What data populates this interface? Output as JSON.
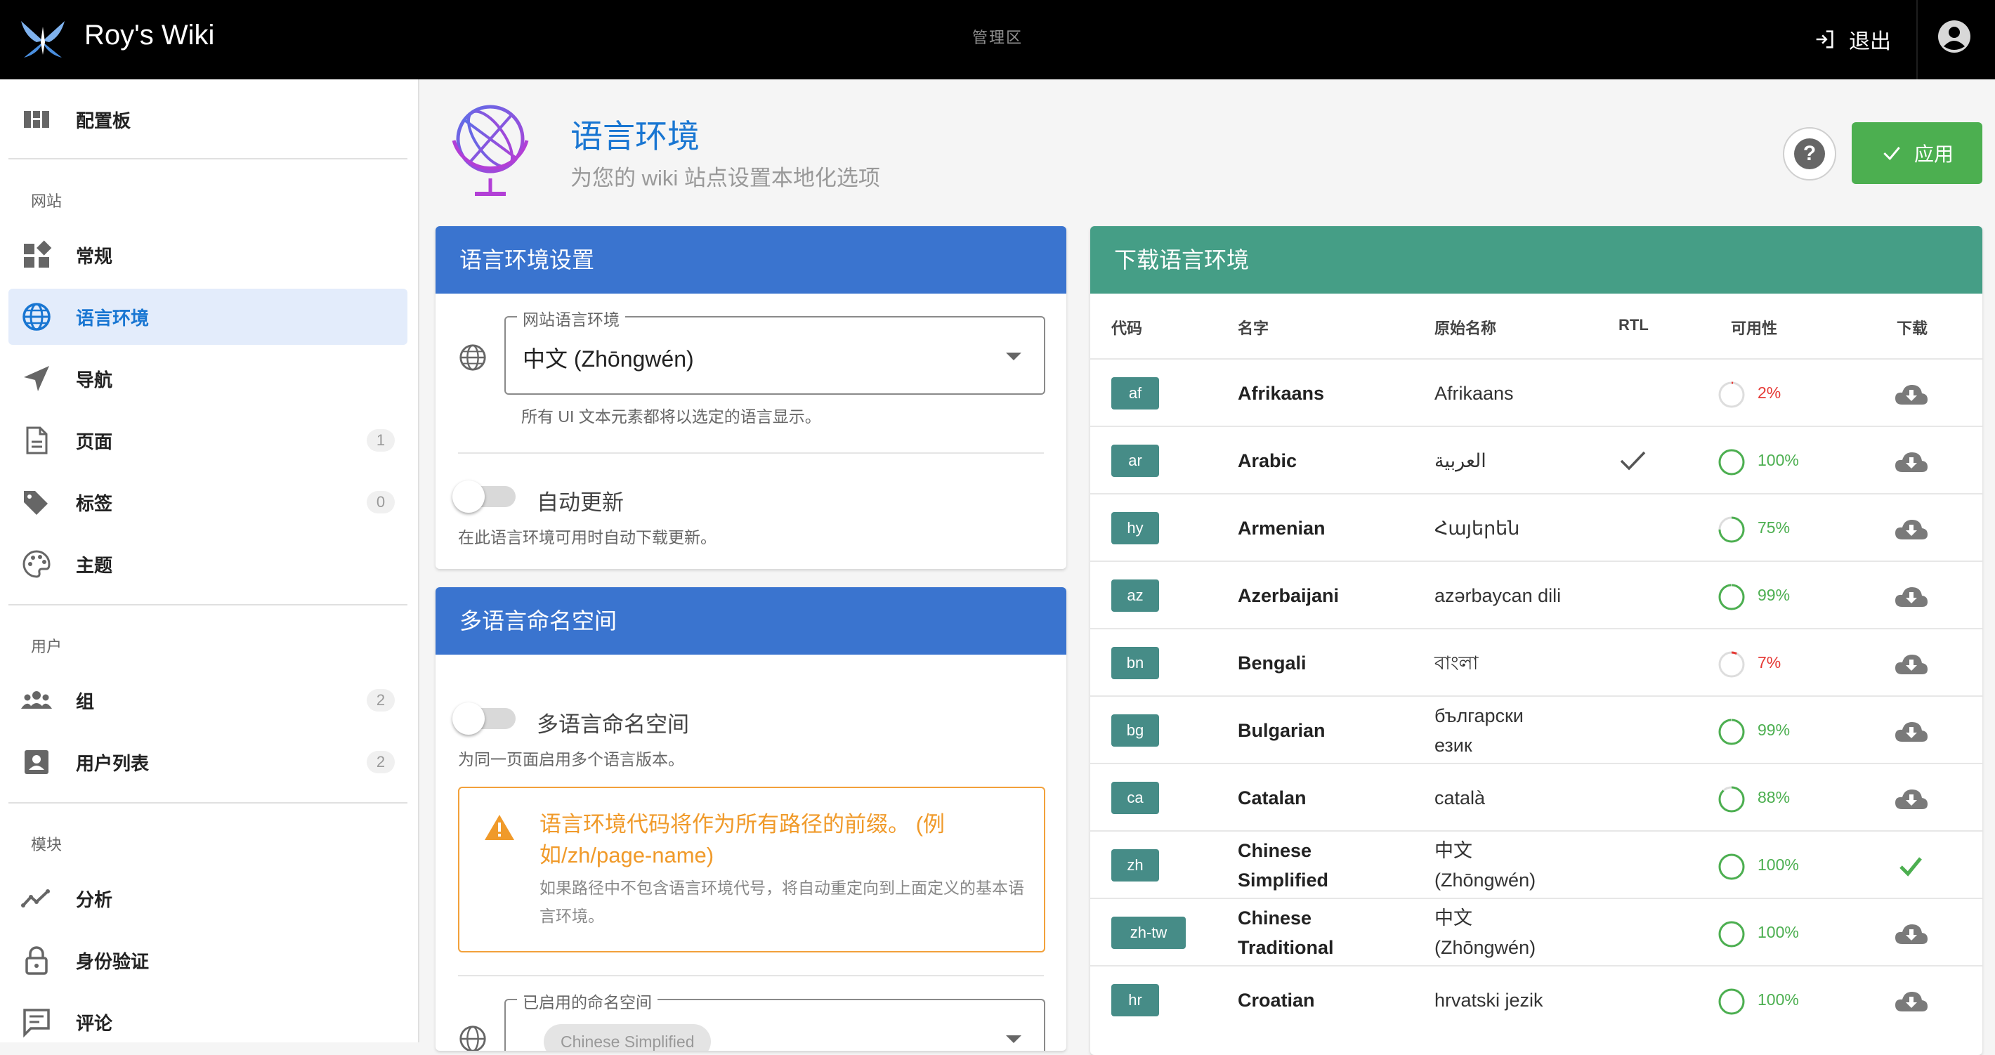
{
  "topbar": {
    "title": "Roy's Wiki",
    "center_label": "管理区",
    "logout_label": "退出",
    "icons": {
      "logo": "wiki-logo",
      "logout": "logout-icon",
      "account": "account-circle-icon"
    }
  },
  "sidebar": {
    "dashboard": {
      "label": "配置板",
      "icon": "dashboard-icon"
    },
    "sections": [
      {
        "label": "网站"
      },
      {
        "label": "用户"
      },
      {
        "label": "模块"
      }
    ],
    "site_items": [
      {
        "label": "常规",
        "icon": "widgets-icon"
      },
      {
        "label": "语言环境",
        "icon": "globe-icon",
        "active": true
      },
      {
        "label": "导航",
        "icon": "navigation-icon"
      },
      {
        "label": "页面",
        "icon": "page-icon",
        "count": "1"
      },
      {
        "label": "标签",
        "icon": "tags-icon",
        "count": "0"
      },
      {
        "label": "主题",
        "icon": "palette-icon"
      }
    ],
    "user_items": [
      {
        "label": "组",
        "icon": "group-icon",
        "count": "2"
      },
      {
        "label": "用户列表",
        "icon": "user-list-icon",
        "count": "2"
      }
    ],
    "module_items": [
      {
        "label": "分析",
        "icon": "analytics-icon"
      },
      {
        "label": "身份验证",
        "icon": "lock-icon"
      },
      {
        "label": "评论",
        "icon": "comment-icon"
      }
    ]
  },
  "header": {
    "title": "语言环境",
    "subtitle": "为您的 wiki 站点设置本地化选项",
    "help_icon": "help-circle-icon",
    "apply_label": "应用"
  },
  "locale_settings": {
    "title": "语言环境设置",
    "site_locale_label": "网站语言环境",
    "site_locale_value": "中文 (Zhōngwén)",
    "site_locale_hint": "所有 UI 文本元素都将以选定的语言显示。",
    "auto_update_label": "自动更新",
    "auto_update_on": false,
    "auto_update_hint": "在此语言环境可用时自动下载更新。"
  },
  "namespaces": {
    "title": "多语言命名空间",
    "toggle_label": "多语言命名空间",
    "toggle_on": false,
    "toggle_hint": "为同一页面启用多个语言版本。",
    "warning_title": "语言环境代码将作为所有路径的前缀。 (例如/zh/page-name)",
    "warning_text": "如果路径中不包含语言环境代号，将自动重定向到上面定义的基本语言环境。",
    "enabled_label": "已启用的命名空间",
    "enabled_chip": "Chinese Simplified"
  },
  "download": {
    "title": "下载语言环境",
    "columns": {
      "code": "代码",
      "name": "名字",
      "native": "原始名称",
      "rtl": "RTL",
      "availability": "可用性",
      "download": "下载"
    },
    "rows": [
      {
        "code": "af",
        "name": "Afrikaans",
        "native": "Afrikaans",
        "rtl": false,
        "availability": 2,
        "installed": false
      },
      {
        "code": "ar",
        "name": "Arabic",
        "native": "العربية",
        "rtl": true,
        "availability": 100,
        "installed": false
      },
      {
        "code": "hy",
        "name": "Armenian",
        "native": "Հայերեն",
        "rtl": false,
        "availability": 75,
        "installed": false
      },
      {
        "code": "az",
        "name": "Azerbaijani",
        "native": "azərbaycan dili",
        "rtl": false,
        "availability": 99,
        "installed": false
      },
      {
        "code": "bn",
        "name": "Bengali",
        "native": "বাংলা",
        "rtl": false,
        "availability": 7,
        "installed": false
      },
      {
        "code": "bg",
        "name": "Bulgarian",
        "native": "български език",
        "rtl": false,
        "availability": 99,
        "installed": false
      },
      {
        "code": "ca",
        "name": "Catalan",
        "native": "català",
        "rtl": false,
        "availability": 88,
        "installed": false
      },
      {
        "code": "zh",
        "name": "Chinese Simplified",
        "native": "中文 (Zhōngwén)",
        "rtl": false,
        "availability": 100,
        "installed": true
      },
      {
        "code": "zh-tw",
        "name": "Chinese Traditional",
        "native": "中文 (Zhōngwén)",
        "rtl": false,
        "availability": 100,
        "installed": false
      },
      {
        "code": "hr",
        "name": "Croatian",
        "native": "hrvatski jezik",
        "rtl": false,
        "availability": 100,
        "installed": false
      }
    ]
  },
  "colors": {
    "topbar": "#000000",
    "accent_blue": "#1976d2",
    "card_blue": "#3a74cf",
    "card_teal": "#459e86",
    "apply_green": "#4caf50",
    "warning_orange": "#f09a2a",
    "avail_green": "#4caf50",
    "avail_red": "#e53935"
  }
}
